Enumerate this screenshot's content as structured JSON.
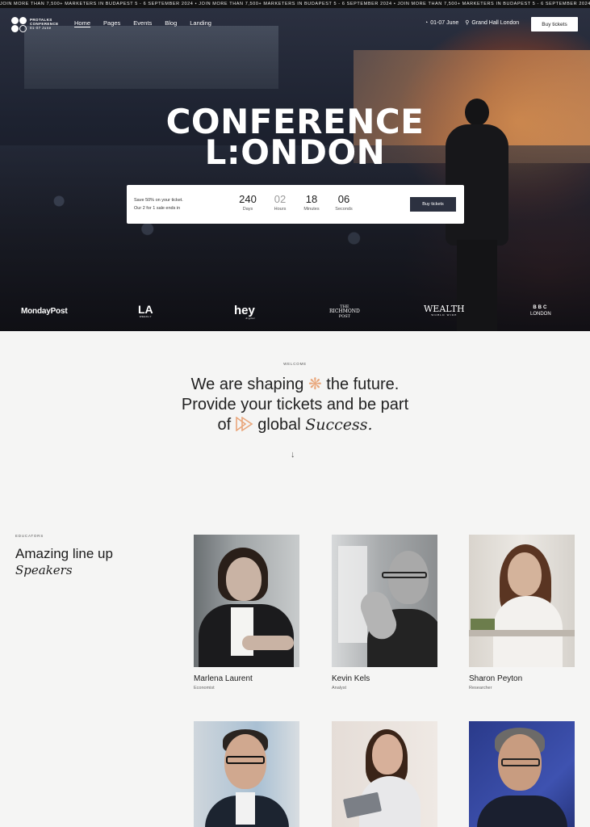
{
  "ticker": "JOIN MORE THAN 7,500+ MARKETERS IN BUDAPEST 5 - 6 SEPTEMBER 2024 • JOIN MORE THAN 7,500+ MARKETERS IN BUDAPEST 5 - 6 SEPTEMBER 2024 • JOIN MORE THAN 7,500+ MARKETERS IN BUDAPEST 5 - 6 SEPTEMBER 2024 • JOIN MORE THAN 7,500+ MARKETERS IN BUDAPEST",
  "logo": {
    "line1": "PROTALKS",
    "line2": "CONFERENCE",
    "line3": "01-07 June"
  },
  "nav": {
    "links": [
      "Home",
      "Pages",
      "Events",
      "Blog",
      "Landing"
    ],
    "date": "01-07 June",
    "location": "Grand Hall London",
    "cta": "Buy tickets"
  },
  "hero": {
    "title_line1": "CONFERENCE",
    "title_line2": "L:ONDON",
    "promo_line1": "Save 50% on your ticket.",
    "promo_line2": "Our 2 for 1 sale ends in",
    "countdown": [
      {
        "value": "240",
        "label": "Days"
      },
      {
        "value": "02",
        "label": "Hours"
      },
      {
        "value": "18",
        "label": "Minutes"
      },
      {
        "value": "06",
        "label": "Seconds"
      }
    ],
    "cta": "Buy tickets"
  },
  "sponsors": {
    "mondaypost": "MondayPost",
    "la": "LA",
    "la_sub": "WEEKLY",
    "hey": "hey",
    "hey_sub": "digital",
    "richmond1": "THE",
    "richmond2": "RICHMOND",
    "richmond3": "POST",
    "wealth": "WEALTH",
    "wealth_sub": "WORLD WIDE",
    "bbc": "BBC",
    "bbc_sub": "LONDON"
  },
  "welcome": {
    "eyebrow": "WELCOME",
    "line1a": "We are shaping",
    "line1b": "the future.",
    "line2": "Provide your tickets and be part",
    "line3a": "of",
    "line3b": "global",
    "line3c": "Success."
  },
  "speakers": {
    "eyebrow": "EDUCATORS",
    "title": "Amazing line up",
    "title_italic": "Speakers",
    "items": [
      {
        "name": "Marlena Laurent",
        "role": "Economist"
      },
      {
        "name": "Kevin Kels",
        "role": "Analyst"
      },
      {
        "name": "Sharon Peyton",
        "role": "Researcher"
      }
    ]
  },
  "colors": {
    "accent": "#e9a77c",
    "dark": "#2c3140",
    "background": "#f5f5f4"
  }
}
